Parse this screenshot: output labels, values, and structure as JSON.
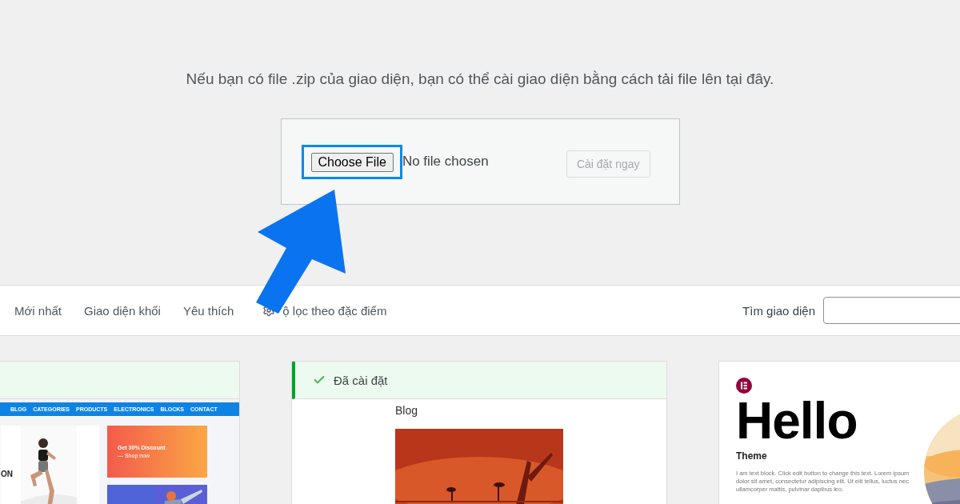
{
  "intro": "Nếu bạn có file .zip của giao diện, bạn có thể cài giao diện bằng cách tải file lên tại đây.",
  "upload": {
    "choose_button": "Choose File",
    "file_status": "No file chosen",
    "highlighted": true,
    "install_button": {
      "label": "Cài đặt ngay",
      "disabled": true
    }
  },
  "filter_bar": {
    "tabs": [
      {
        "label": "Mới nhất"
      },
      {
        "label": "Giao diện khối"
      },
      {
        "label": "Yêu thích"
      }
    ],
    "feature_filter": "ộ lọc theo đặc điểm",
    "search_label": "Tìm giao diện"
  },
  "themes": [
    {
      "kind": "shop",
      "installed": true,
      "nav": [
        "BLOG",
        "CATEGORIES",
        "PRODUCTS",
        "ELECTRONICS",
        "BLOCKS",
        "CONTACT"
      ],
      "hero_text": "ON",
      "promo_title": "Get 30% Discount",
      "promo_link": "— Shop now"
    },
    {
      "kind": "blog",
      "installed": true,
      "status": "Đã cài đặt",
      "heading": "Blog"
    },
    {
      "kind": "hello",
      "installed": false,
      "title": "Hello",
      "subtitle": "Theme",
      "body": "I am text block. Click edit button to change this text. Lorem ipsum dolor sit amet, consectetur adipiscing elit. Ut elit tellus, luctus nec ullamcorper mattis, pulvinar dapibus leo."
    }
  ]
}
